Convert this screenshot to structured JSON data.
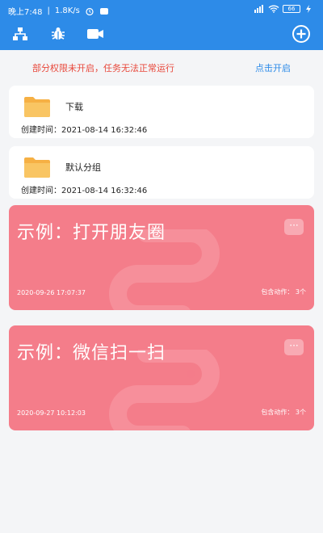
{
  "status_bar": {
    "time": "晚上7:48",
    "speed": "1.8K/s",
    "battery": "66"
  },
  "toolbar": {
    "icons": [
      "hierarchy-icon",
      "bug-icon",
      "video-icon",
      "add-circle-icon"
    ]
  },
  "warning": {
    "message": "部分权限未开启，任务无法正常运行",
    "action": "点击开启"
  },
  "groups": [
    {
      "name": "下载",
      "created": "创建时间：2021-08-14  16:32:46"
    },
    {
      "name": "默认分组",
      "created": "创建时间：2021-08-14  16:32:46"
    }
  ],
  "tasks": [
    {
      "title": "示例：打开朋友圈",
      "date": "2020-09-26  17:07:37",
      "actions": "包含动作：  3个"
    },
    {
      "title": "示例：微信扫一扫",
      "date": "2020-09-27  10:12:03",
      "actions": "包含动作：  3个"
    }
  ],
  "colors": {
    "primary": "#2d8be8",
    "warning": "#e8483b",
    "task_card": "#f47d8a",
    "folder": "#f6b044"
  }
}
